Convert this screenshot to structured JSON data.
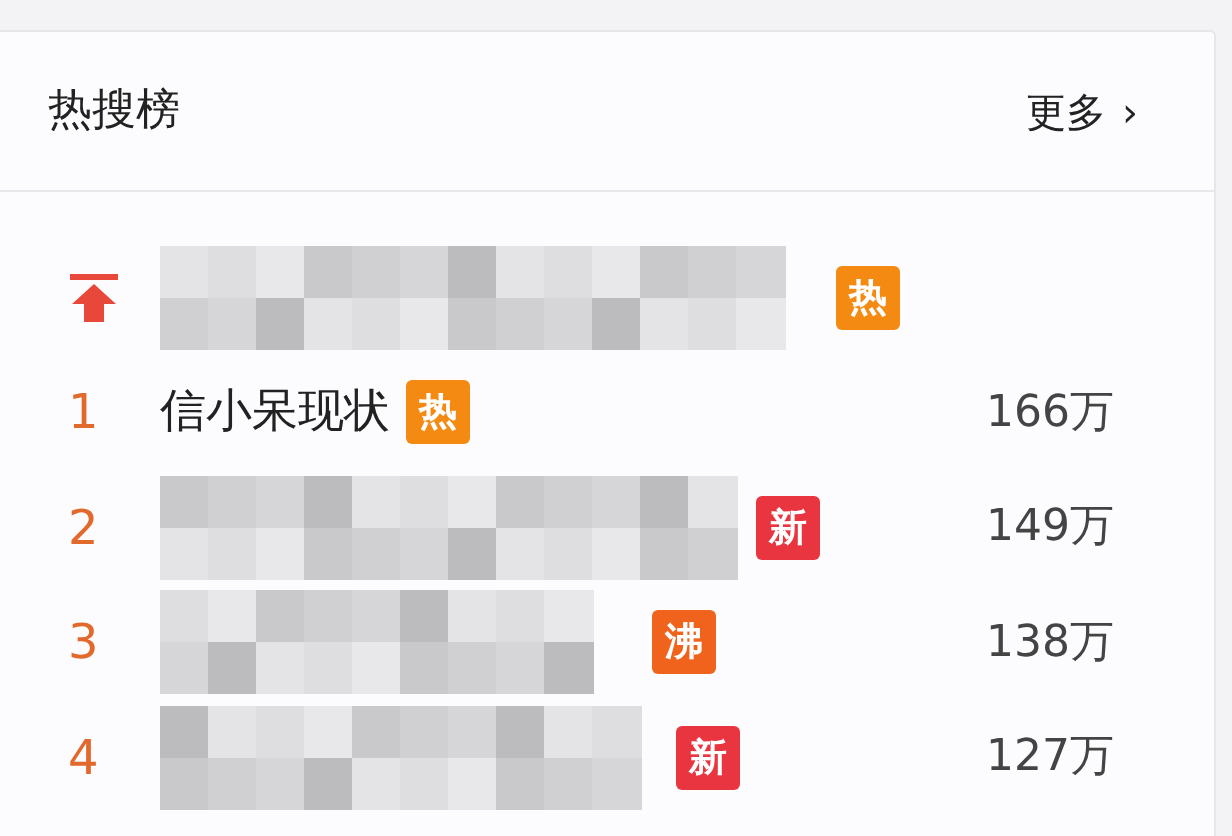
{
  "panel": {
    "title": "热搜榜",
    "more_link": "更多",
    "more_arrow": "›"
  },
  "rows": [
    {
      "kind": "pinned",
      "badge": {
        "text": "热",
        "color": "#f58a12"
      }
    },
    {
      "kind": "ranked",
      "rank": "1",
      "title": "信小呆现状",
      "badge": {
        "text": "热",
        "color": "#f58a12"
      },
      "count": "166万"
    },
    {
      "kind": "ranked_pixelated",
      "rank": "2",
      "badge": {
        "text": "新",
        "color": "#e8353f"
      },
      "count": "149万"
    },
    {
      "kind": "ranked_pixelated",
      "rank": "3",
      "badge": {
        "text": "沸",
        "color": "#f0631c"
      },
      "count": "138万"
    },
    {
      "kind": "ranked_pixelated",
      "rank": "4",
      "badge": {
        "text": "新",
        "color": "#e8353f"
      },
      "count": "127万"
    }
  ]
}
